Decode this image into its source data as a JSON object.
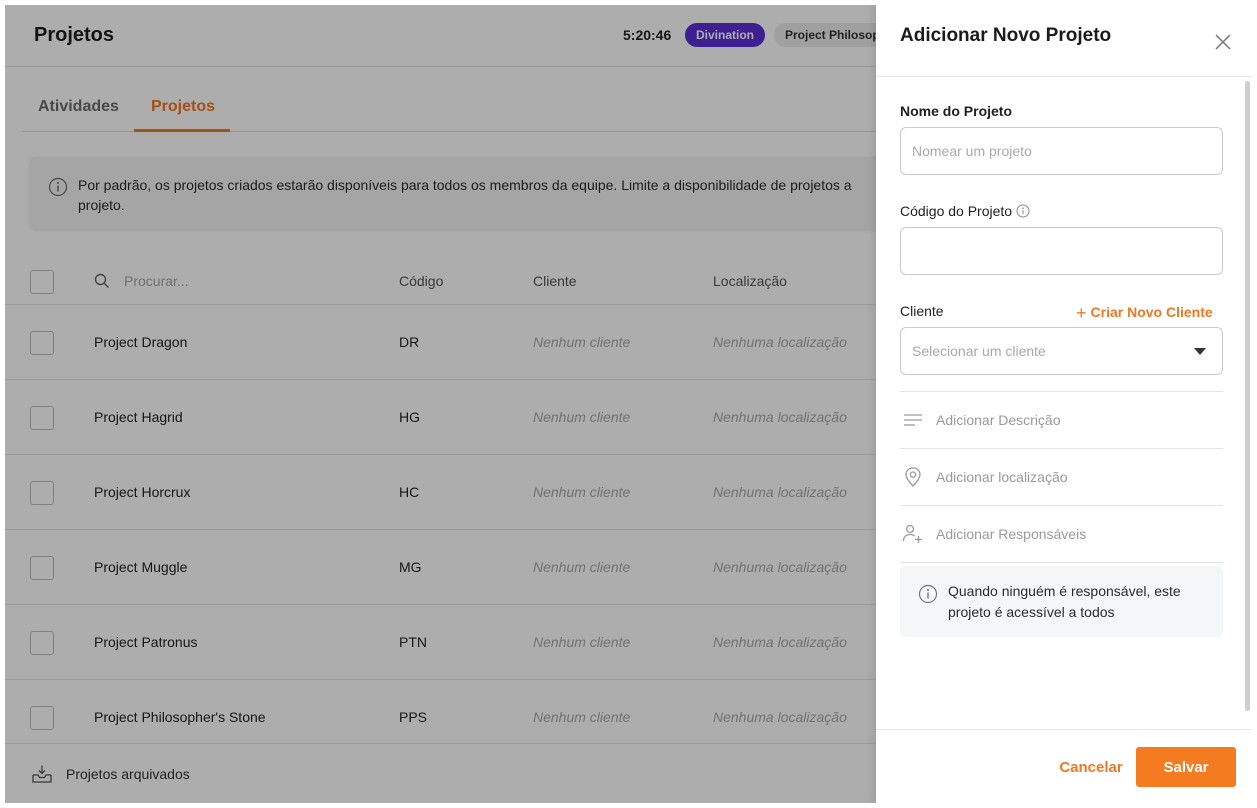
{
  "header": {
    "title": "Projetos",
    "timer": "5:20:46",
    "active_activity": "Divination",
    "active_project": "Project Philosopher's Stone"
  },
  "tabs": [
    {
      "label": "Atividades",
      "active": false
    },
    {
      "label": "Projetos",
      "active": true
    }
  ],
  "notice": {
    "icon": "info-icon",
    "text": "Por padrão, os projetos criados estarão disponíveis para todos os membros da equipe. Limite a disponibilidade de projetos a",
    "text_continued": "projeto."
  },
  "table": {
    "search_placeholder": "Procurar...",
    "columns": [
      "Código",
      "Cliente",
      "Localização"
    ],
    "rows": [
      {
        "name": "Project Dragon",
        "code": "DR",
        "client": "Nenhum cliente",
        "location": "Nenhuma localização"
      },
      {
        "name": "Project Hagrid",
        "code": "HG",
        "client": "Nenhum cliente",
        "location": "Nenhuma localização"
      },
      {
        "name": "Project Horcrux",
        "code": "HC",
        "client": "Nenhum cliente",
        "location": "Nenhuma localização"
      },
      {
        "name": "Project Muggle",
        "code": "MG",
        "client": "Nenhum cliente",
        "location": "Nenhuma localização"
      },
      {
        "name": "Project Patronus",
        "code": "PTN",
        "client": "Nenhum cliente",
        "location": "Nenhuma localização"
      },
      {
        "name": "Project Philosopher's Stone",
        "code": "PPS",
        "client": "Nenhum cliente",
        "location": "Nenhuma localização"
      }
    ]
  },
  "footer": {
    "archived_label": "Projetos arquivados"
  },
  "drawer": {
    "title": "Adicionar Novo Projeto",
    "name_label": "Nome do Projeto",
    "name_placeholder": "Nomear um projeto",
    "name_value": "",
    "code_label": "Código do Projeto",
    "code_value": "",
    "client_label": "Cliente",
    "new_client_label": "Criar Novo Cliente",
    "client_placeholder": "Selecionar um cliente",
    "options": [
      {
        "label": "Adicionar Descrição",
        "icon": "text-lines-icon"
      },
      {
        "label": "Adicionar localização",
        "icon": "location-pin-icon"
      },
      {
        "label": "Adicionar Responsáveis",
        "icon": "add-user-icon"
      }
    ],
    "hint": "Quando ninguém é responsável, este projeto é acessível a todos",
    "cancel_label": "Cancelar",
    "save_label": "Salvar"
  },
  "colors": {
    "accent": "#f47b20",
    "badge_purple": "#5a2fd6"
  }
}
